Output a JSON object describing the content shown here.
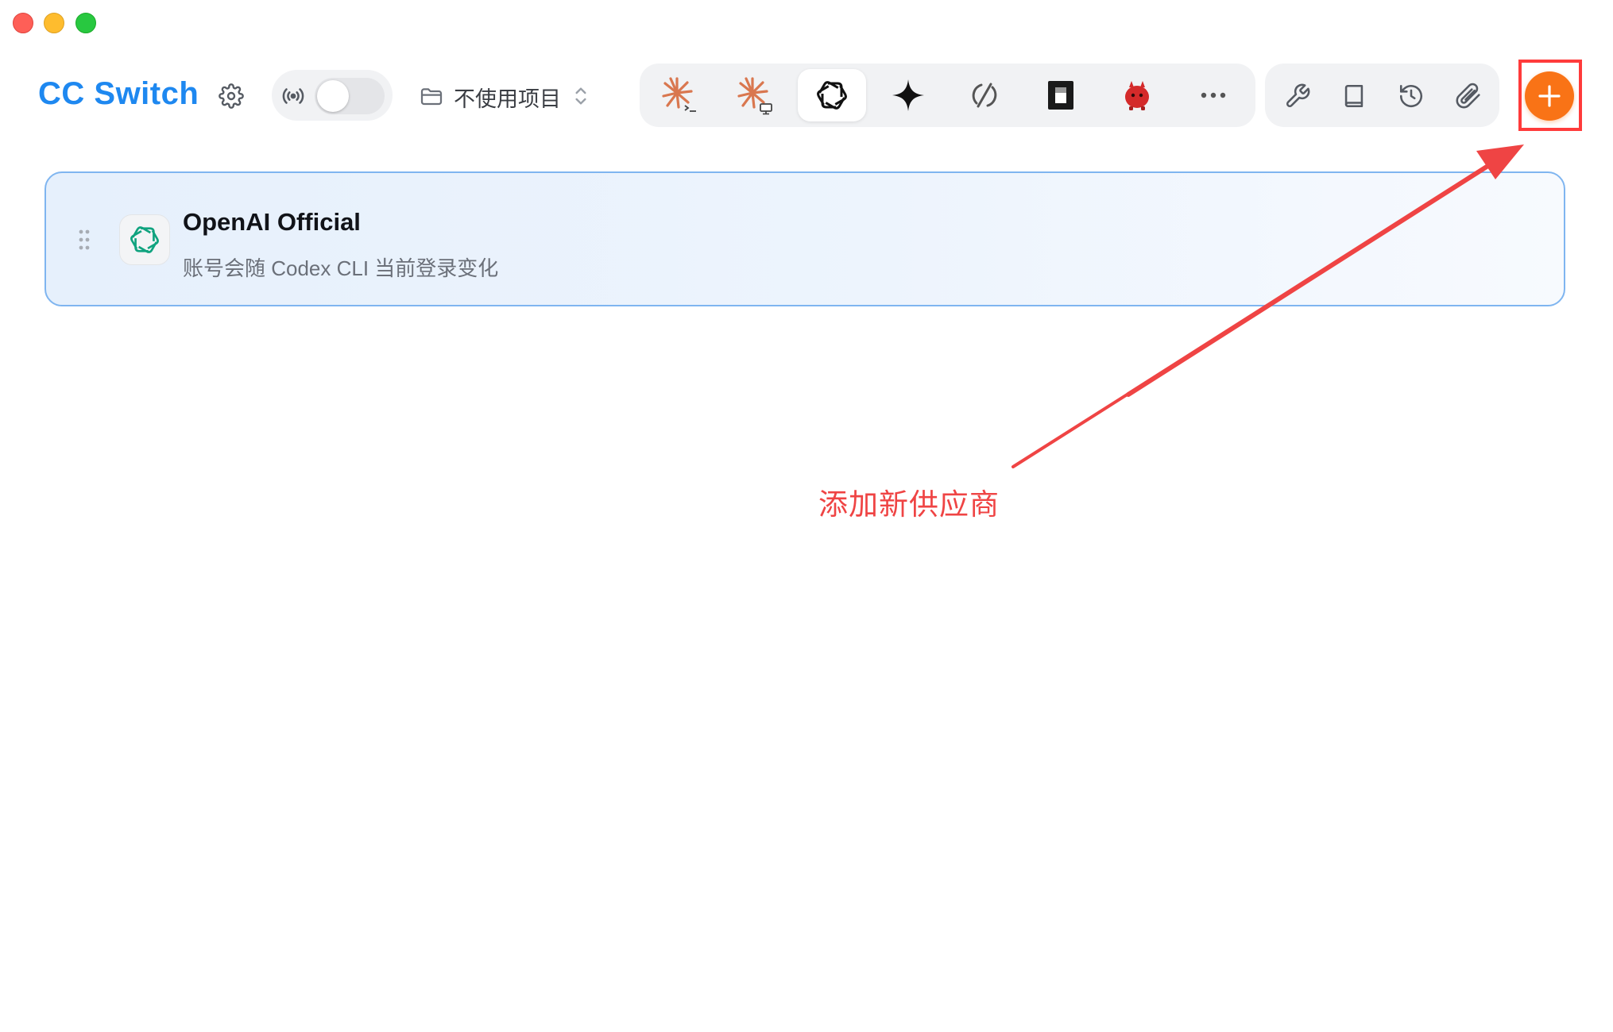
{
  "window": {
    "controls": [
      "close",
      "minimize",
      "zoom"
    ]
  },
  "header": {
    "app_title": "CC Switch",
    "settings_icon": "gear-icon",
    "proxy": {
      "icon": "broadcast-icon",
      "enabled": false
    },
    "project": {
      "icon": "folder-icon",
      "label": "不使用项目",
      "chevron": "chevron-updown-icon"
    }
  },
  "app_switcher": {
    "items": [
      {
        "id": "claude-code",
        "icon": "claude-terminal-icon",
        "color": "#d9774f",
        "active": false
      },
      {
        "id": "claude-desktop",
        "icon": "claude-desktop-icon",
        "color": "#d9774f",
        "active": false
      },
      {
        "id": "codex",
        "icon": "openai-icon",
        "color": "#111111",
        "active": true
      },
      {
        "id": "gemini",
        "icon": "sparkle-icon",
        "color": "#111111",
        "active": false
      },
      {
        "id": "opencode",
        "icon": "slashed-circle-icon",
        "color": "#555555",
        "active": false
      },
      {
        "id": "terminal-app",
        "icon": "dark-tile-icon",
        "color": "#1a1a1a",
        "active": false
      },
      {
        "id": "mascot-app",
        "icon": "red-mascot-icon",
        "color": "#d42a2a",
        "active": false
      },
      {
        "id": "more",
        "icon": "more-icon",
        "color": "#555555",
        "active": false
      }
    ]
  },
  "toolbar": {
    "items": [
      {
        "id": "tools",
        "icon": "wrench-icon"
      },
      {
        "id": "docs",
        "icon": "book-icon"
      },
      {
        "id": "history",
        "icon": "history-icon"
      },
      {
        "id": "attachments",
        "icon": "paperclip-icon"
      }
    ],
    "add": {
      "icon": "plus-icon",
      "color": "#f97316"
    }
  },
  "providers": [
    {
      "name": "OpenAI Official",
      "description": "账号会随 Codex CLI 当前登录变化",
      "logo": "openai-icon",
      "logo_color": "#10a37f",
      "active": true
    }
  ],
  "annotation": {
    "text": "添加新供应商",
    "color": "#ef4444"
  }
}
